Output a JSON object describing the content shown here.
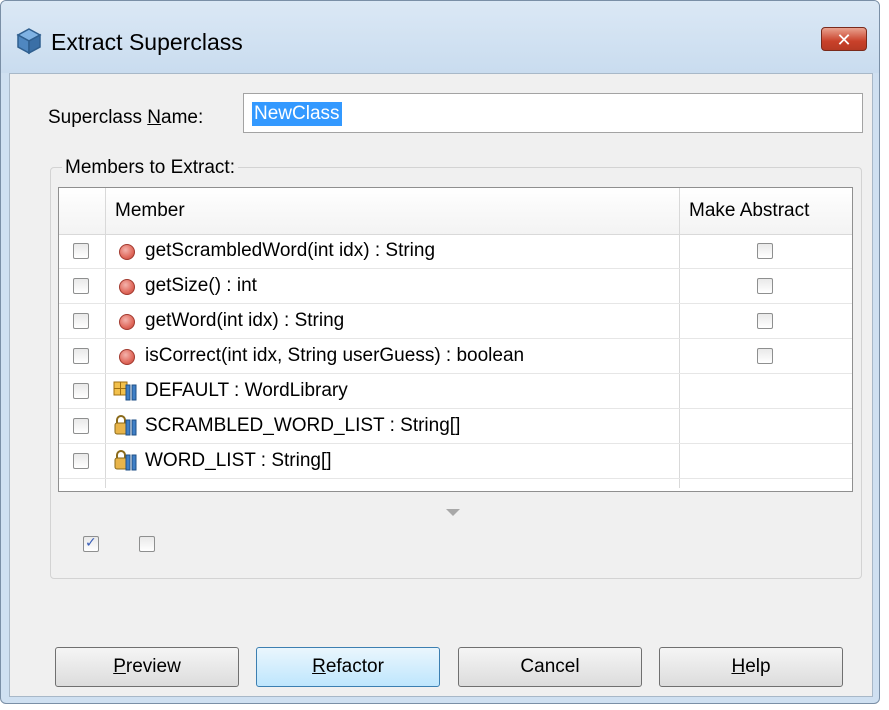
{
  "window": {
    "title": "Extract Superclass",
    "close_label": "✕"
  },
  "superclass": {
    "label_prefix": "Superclass ",
    "label_mnemonic": "N",
    "label_suffix": "ame:",
    "value": "NewClass"
  },
  "members": {
    "group_label": "Members to Extract:",
    "columns": [
      "Member",
      "Make Abstract"
    ],
    "rows": [
      {
        "text": "getScrambledWord(int idx) : String",
        "kind": "method",
        "selected": false,
        "make_abstract": false
      },
      {
        "text": "getSize() : int",
        "kind": "method",
        "selected": false,
        "make_abstract": false
      },
      {
        "text": "getWord(int idx) : String",
        "kind": "method",
        "selected": false,
        "make_abstract": false
      },
      {
        "text": "isCorrect(int idx, String userGuess) : boolean",
        "kind": "method",
        "selected": false,
        "make_abstract": false
      },
      {
        "text": "DEFAULT : WordLibrary",
        "kind": "field",
        "selected": false
      },
      {
        "text": "SCRAMBLED_WORD_LIST : String[]",
        "kind": "field-locked",
        "selected": false
      },
      {
        "text": "WORD_LIST : String[]",
        "kind": "field-locked",
        "selected": false
      }
    ]
  },
  "options": {
    "checkbox1_checked": true,
    "checkbox2_checked": false
  },
  "buttons": [
    {
      "mnemonic": "P",
      "rest": "review"
    },
    {
      "mnemonic": "R",
      "rest": "efactor"
    },
    {
      "mnemonic": "",
      "rest": "Cancel"
    },
    {
      "mnemonic": "H",
      "rest": "elp"
    }
  ],
  "icons": {
    "title": "class-cube-icon",
    "method": "method-red-dot-icon",
    "field": "field-icon",
    "locked_field": "locked-field-icon"
  },
  "colors": {
    "selection": "#3399ff",
    "default_button": "#bee6fd",
    "close_button": "#c9412a"
  }
}
